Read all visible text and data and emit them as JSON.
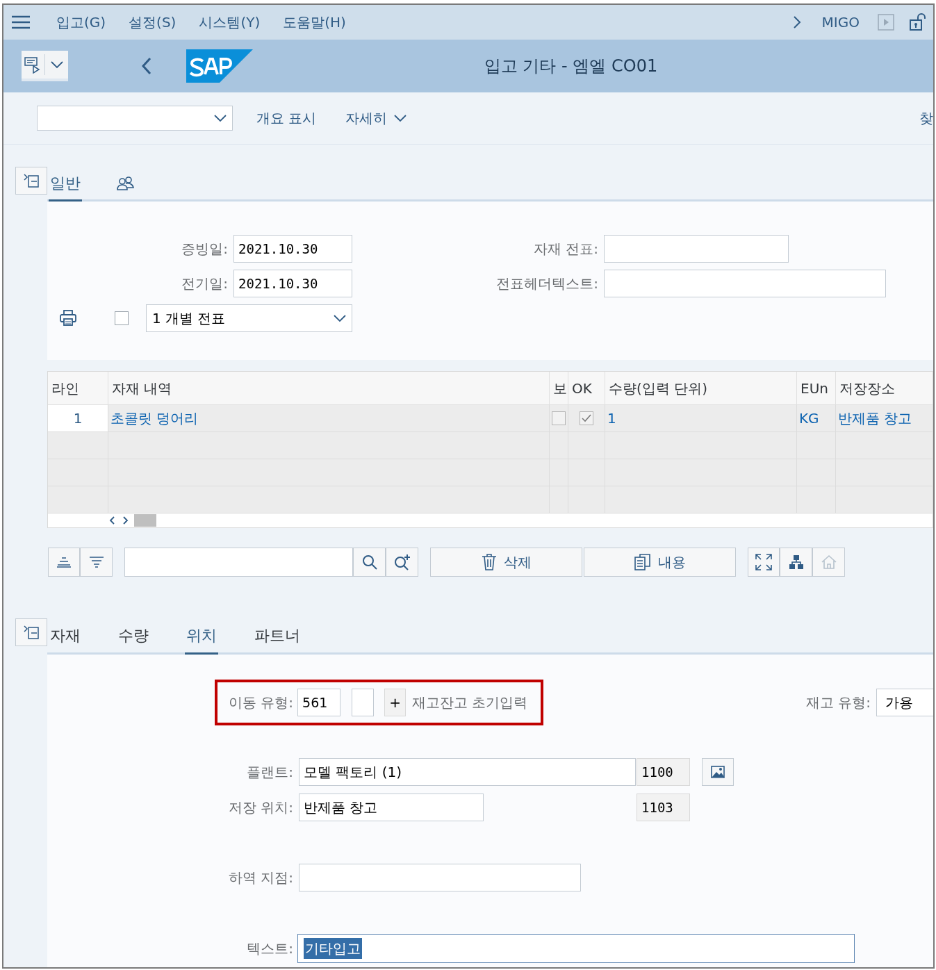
{
  "menu_bar": {
    "menus": [
      "입고(G)",
      "설정(S)",
      "시스템(Y)",
      "도움말(H)"
    ],
    "transaction": "MIGO"
  },
  "title_bar": {
    "title": "입고 기타 - 엠엘 CO01"
  },
  "toolbar": {
    "items": [
      {
        "label": "개요 표시",
        "kind": "plain"
      },
      {
        "label": "자세히",
        "kind": "menu"
      }
    ],
    "cut_item": "찾"
  },
  "header_tabs": [
    {
      "kind": "text",
      "label": "일반",
      "selected": true
    },
    {
      "kind": "icon",
      "selected": false
    }
  ],
  "header_fields": {
    "document_date": {
      "label": "증빙일:",
      "value": "2021.10.30"
    },
    "posting_date": {
      "label": "전기일:",
      "value": "2021.10.30"
    },
    "material_slip": {
      "label": "자재 전표:"
    },
    "header_text": {
      "label": "전표헤더텍스트:"
    },
    "print": {
      "checked": false,
      "value": "1 개별 전표"
    }
  },
  "items_table": {
    "columns": [
      "라인",
      "자재 내역",
      "보",
      "OK",
      "수량(입력 단위)",
      "EUn",
      "저장장소"
    ],
    "rows": [
      {
        "line": "1",
        "material": "초콜릿 덩어리",
        "flag": false,
        "ok": true,
        "quantity": "1",
        "unit": "KG",
        "storage": "반제품 창고"
      }
    ]
  },
  "table_buttons": [
    "삭제",
    "내용"
  ],
  "detail_tabs": [
    {
      "label": "자재",
      "selected": false
    },
    {
      "label": "수량",
      "selected": false
    },
    {
      "label": "위치",
      "selected": true
    },
    {
      "label": "파트너",
      "selected": false
    }
  ],
  "movement": {
    "label": "이동 유형:",
    "code": "561",
    "sign": "+",
    "description": "재고잔고 초기입력",
    "highlighted": true
  },
  "stock_type": {
    "label": "재고 유형:",
    "value": "가용"
  },
  "plant": {
    "label": "플랜트:",
    "value": "모델 팩토리 (1)",
    "code": "1100"
  },
  "storage_location": {
    "label": "저장 위치:",
    "value": "반제품 창고",
    "code": "1103"
  },
  "unloading_point": {
    "label": "하역 지점:"
  },
  "text": {
    "label": "텍스트:",
    "value": "기타입고",
    "selected": true
  }
}
